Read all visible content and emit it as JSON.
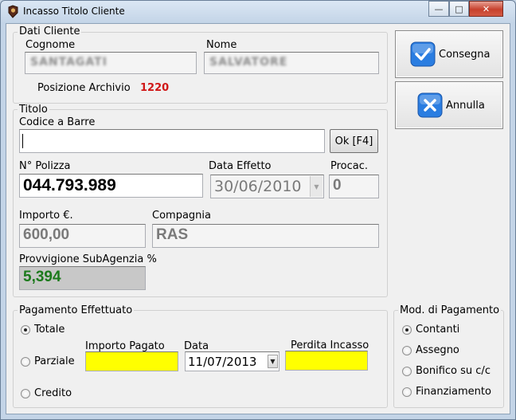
{
  "window": {
    "title": "Incasso Titolo Cliente"
  },
  "dati_cliente": {
    "legend": "Dati Cliente",
    "cognome_label": "Cognome",
    "cognome_value": "SANTAGATI",
    "nome_label": "Nome",
    "nome_value": "SALVATORE",
    "posizione_label": "Posizione Archivio",
    "posizione_value": "1220"
  },
  "titolo": {
    "legend": "Titolo",
    "barcode_label": "Codice a Barre",
    "barcode_value": "",
    "ok_button": "Ok [F4]",
    "polizza_label": "N° Polizza",
    "polizza_value": "044.793.989",
    "data_effetto_label": "Data Effetto",
    "data_effetto_value": "30/06/2010",
    "procac_label": "Procac.",
    "procac_value": "0",
    "importo_label": "Importo €.",
    "importo_value": "600,00",
    "compagnia_label": "Compagnia",
    "compagnia_value": "RAS",
    "provvigione_label": "Provvigione SubAgenzia %",
    "provvigione_value": "5,394"
  },
  "actions": {
    "consegna": "Consegna",
    "annulla": "Annulla"
  },
  "pagamento": {
    "legend": "Pagamento Effettuato",
    "totale": "Totale",
    "parziale": "Parziale",
    "credito": "Credito",
    "selected": "Totale",
    "importo_pagato_label": "Importo Pagato",
    "data_label": "Data",
    "data_value": "11/07/2013",
    "perdita_label": "Perdita Incasso"
  },
  "mod_pagamento": {
    "legend": "Mod. di Pagamento",
    "options": [
      "Contanti",
      "Assegno",
      "Bonifico su c/c",
      "Finanziamento"
    ],
    "selected": "Contanti"
  },
  "colors": {
    "posizione": "#d01818",
    "provvigione": "#1c7a1c",
    "highlight_field": "#ffff00",
    "action_icon": "#2a7de1"
  }
}
